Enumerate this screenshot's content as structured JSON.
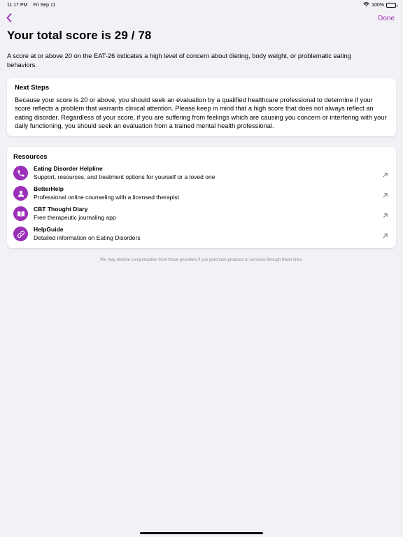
{
  "status_bar": {
    "time": "11:17 PM",
    "date": "Fri Sep 11",
    "battery": "100%",
    "wifi_icon": "wifi-icon",
    "battery_icon": "battery-icon"
  },
  "nav": {
    "back_icon": "chevron-left-icon",
    "done_label": "Done"
  },
  "title": "Your total score is 29 / 78",
  "intro": "A score at or above 20 on the EAT-26 indicates a high level of concern about dieting, body weight, or problematic eating behaviors.",
  "next_steps": {
    "heading": "Next Steps",
    "body": "Because your score is 20 or above, you should seek an evaluation by a qualified healthcare professional to determine if your score reflects a problem that warrants clinical attention. Please keep in mind that a high score that does not always reflect an eating disorder. Regardless of your score, if you are suffering from feelings which are causing you concern or interfering with your daily functioning, you should seek an evaluation from a trained mental health professional."
  },
  "resources": {
    "heading": "Resources",
    "items": [
      {
        "title": "Eating Disorder Helpline",
        "description": "Support, resources, and treatment options for yourself or a loved one",
        "icon": "phone-icon"
      },
      {
        "title": "BetterHelp",
        "description": "Professional online counseling with a licensed therapist",
        "icon": "person-icon"
      },
      {
        "title": "CBT Thought Diary",
        "description": "Free therapeutic journaling app",
        "icon": "book-icon"
      },
      {
        "title": "HelpGuide",
        "description": "Detailed information on Eating Disorders",
        "icon": "link-icon"
      }
    ]
  },
  "footnote": "We may receive compensation from these providers if you purchase products or services through these links.",
  "colors": {
    "accent": "#9c2fb8",
    "background": "#f2f1f6",
    "card": "#ffffff"
  }
}
